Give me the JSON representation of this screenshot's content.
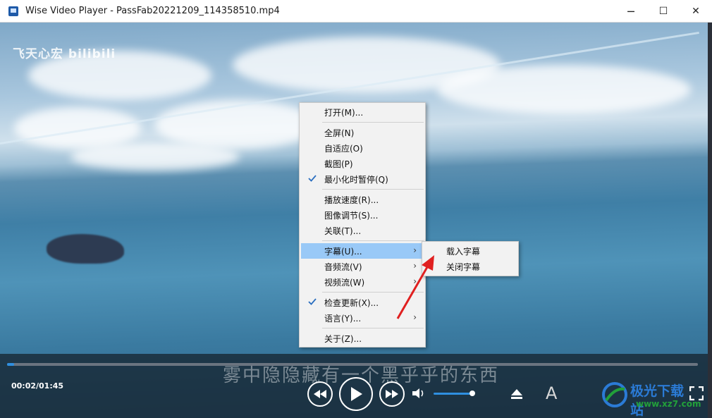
{
  "window": {
    "title": "Wise Video Player - PassFab20221209_114358510.mp4",
    "minimize": "─",
    "maximize": "☐",
    "close": "✕"
  },
  "video": {
    "watermark": "飞天心宏 bilibili",
    "subtitle": "雾中隐隐藏有一个黑乎乎的东西"
  },
  "player": {
    "time": "00:02/01:45",
    "progress_fraction": 0.01,
    "volume_fraction": 0.95,
    "font_button": "A"
  },
  "context_menu": {
    "items": [
      {
        "label": "打开(M)...",
        "checked": false,
        "submenu": false
      },
      {
        "label": "全屏(N)",
        "checked": false,
        "submenu": false
      },
      {
        "label": "自适应(O)",
        "checked": false,
        "submenu": false
      },
      {
        "label": "截图(P)",
        "checked": false,
        "submenu": false
      },
      {
        "label": "最小化时暂停(Q)",
        "checked": true,
        "submenu": false
      },
      {
        "label": "播放速度(R)...",
        "checked": false,
        "submenu": false
      },
      {
        "label": "图像调节(S)...",
        "checked": false,
        "submenu": false
      },
      {
        "label": "关联(T)...",
        "checked": false,
        "submenu": false
      },
      {
        "label": "字幕(U)...",
        "checked": false,
        "submenu": true,
        "highlighted": true
      },
      {
        "label": "音频流(V)",
        "checked": false,
        "submenu": true
      },
      {
        "label": "视频流(W)",
        "checked": false,
        "submenu": true
      },
      {
        "label": "检查更新(X)...",
        "checked": true,
        "submenu": false
      },
      {
        "label": "语言(Y)...",
        "checked": false,
        "submenu": true
      },
      {
        "label": "关于(Z)...",
        "checked": false,
        "submenu": false
      }
    ],
    "arrow_glyph": "›"
  },
  "subtitle_submenu": {
    "items": [
      "载入字幕",
      "关闭字幕"
    ]
  },
  "brand_watermark": {
    "name": "极光下载站",
    "url": "www.xz7.com"
  },
  "colors": {
    "accent": "#2f8fe0",
    "menu_highlight": "#99c9f7",
    "annotation_arrow": "#e02020"
  }
}
